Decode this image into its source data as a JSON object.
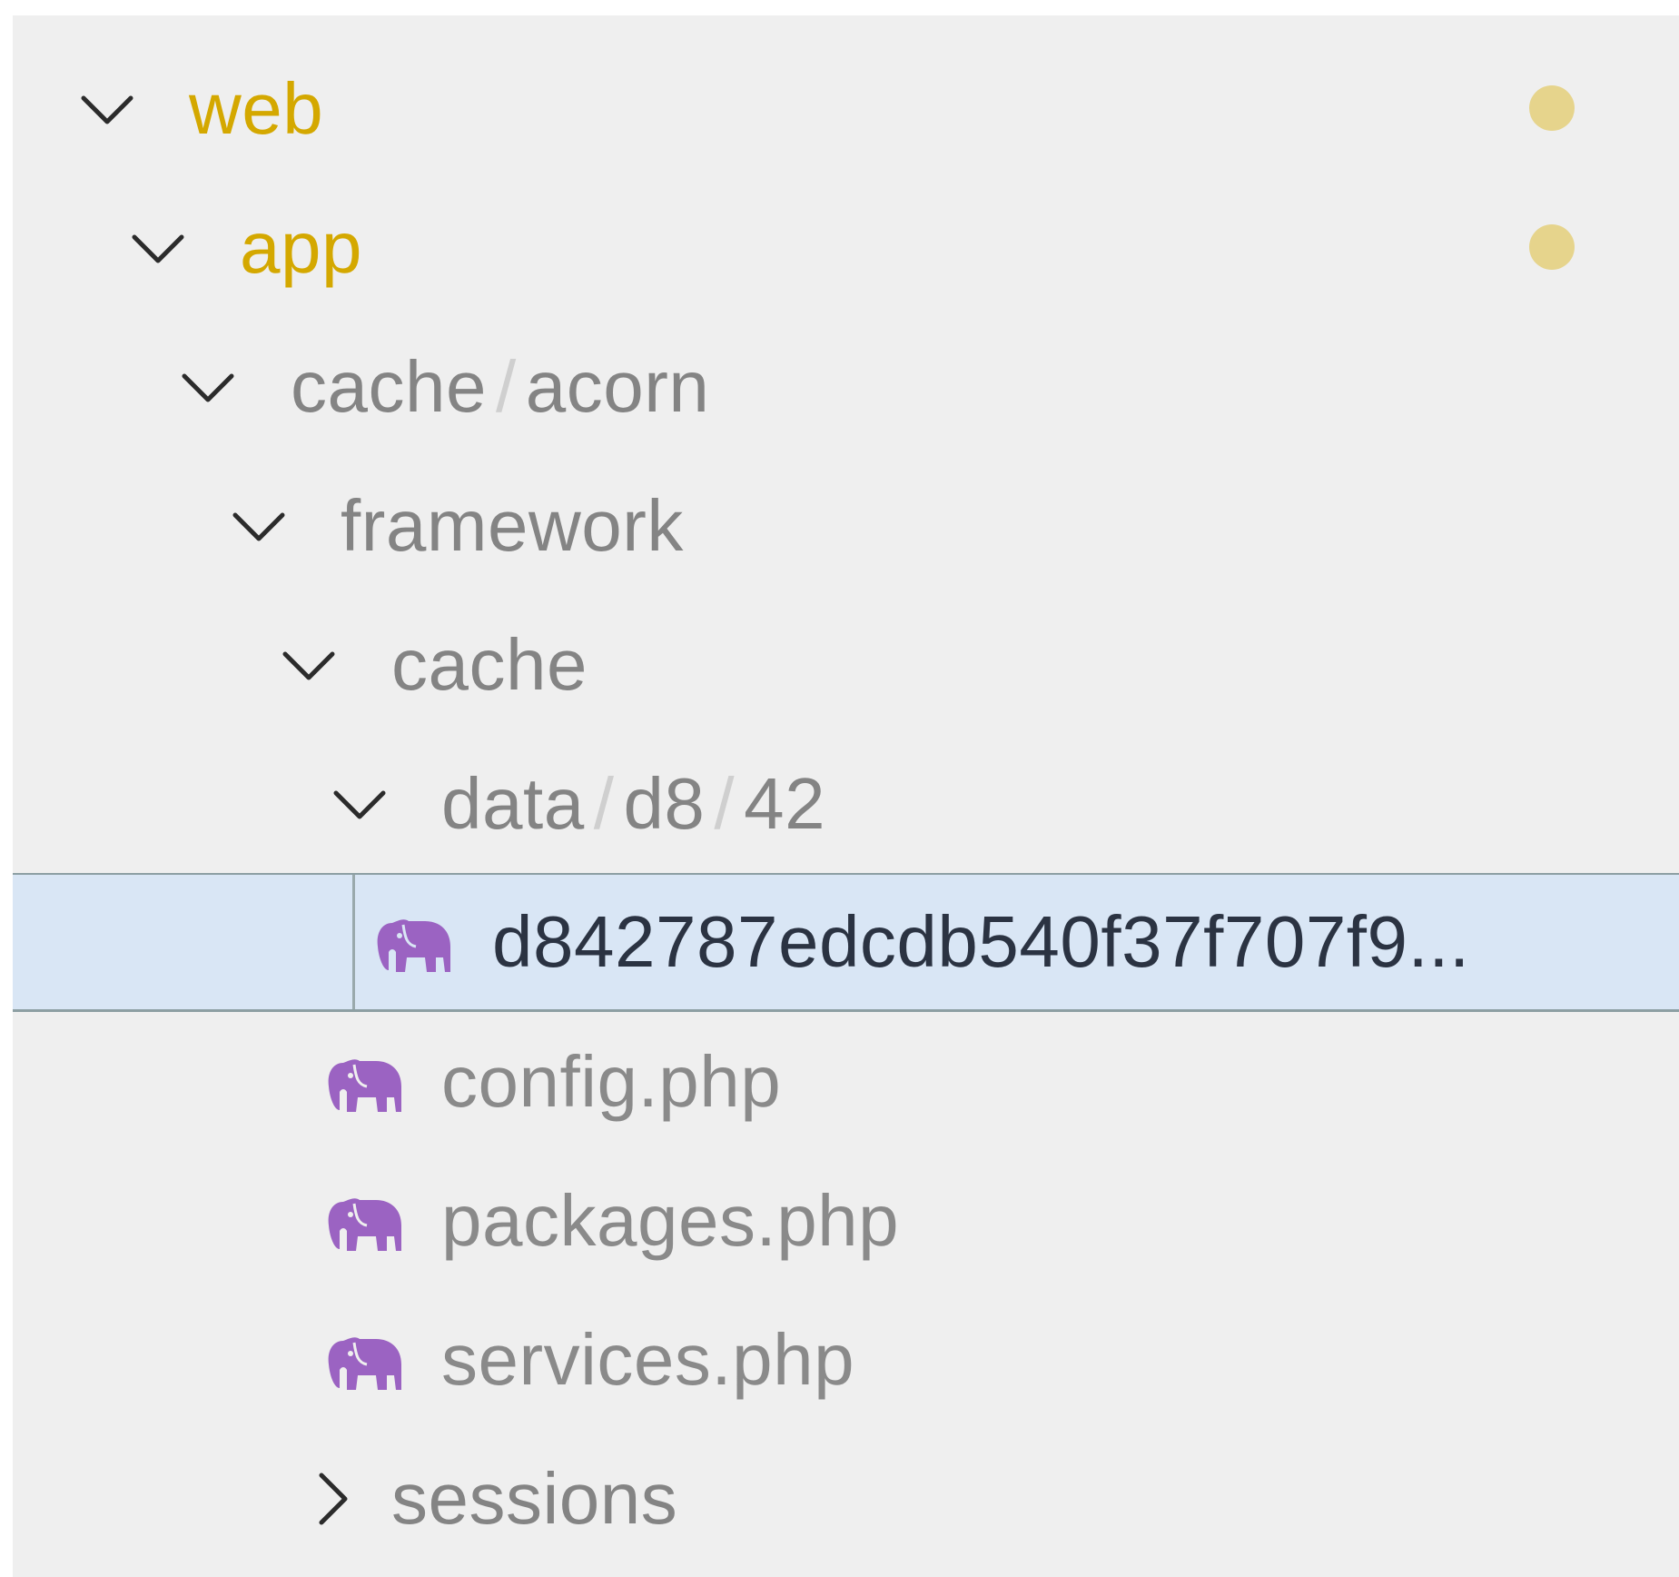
{
  "explorer": {
    "items": [
      {
        "label": "web",
        "kind": "folder",
        "expanded": true,
        "modified": true
      },
      {
        "label": "app",
        "kind": "folder",
        "expanded": true,
        "modified": true
      },
      {
        "segments": [
          "cache",
          "acorn"
        ],
        "kind": "folder",
        "expanded": true
      },
      {
        "label": "framework",
        "kind": "folder",
        "expanded": true
      },
      {
        "label": "cache",
        "kind": "folder",
        "expanded": true
      },
      {
        "segments": [
          "data",
          "d8",
          "42"
        ],
        "kind": "folder",
        "expanded": true
      },
      {
        "label": "d842787edcdb540f37f707f9...",
        "kind": "file",
        "icon": "elephant-icon",
        "selected": true
      },
      {
        "label": "config.php",
        "kind": "file",
        "icon": "elephant-icon"
      },
      {
        "label": "packages.php",
        "kind": "file",
        "icon": "elephant-icon"
      },
      {
        "label": "services.php",
        "kind": "file",
        "icon": "elephant-icon"
      },
      {
        "label": "sessions",
        "kind": "folder",
        "expanded": false
      }
    ],
    "separator": "/"
  },
  "colors": {
    "modified_label": "#d4a800",
    "modified_dot": "#e6d48c",
    "php_icon": "#9b63c2",
    "selected_background": "#d9e6f5",
    "background": "#efefef"
  }
}
